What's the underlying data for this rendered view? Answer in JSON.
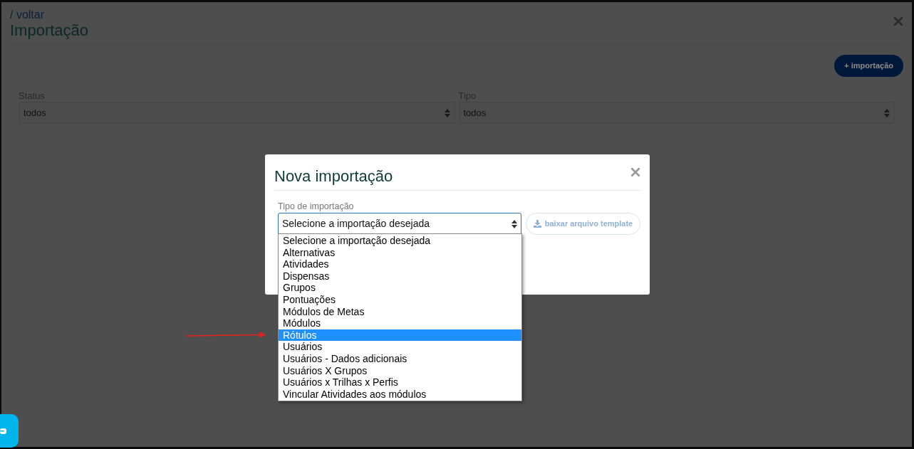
{
  "page": {
    "back_link": "/ voltar",
    "title": "Importação",
    "add_button": "+ importação",
    "filters": [
      {
        "label": "Status",
        "value": "todos"
      },
      {
        "label": "Tipo",
        "value": "todos"
      }
    ]
  },
  "dialog": {
    "title": "Nova importação",
    "field_label": "Tipo de importação",
    "field_value": "Selecione a importação desejada",
    "template_button": {
      "label": "baixar arquivo template",
      "disabled": true
    },
    "options": [
      {
        "label": "Selecione a importação desejada",
        "selected": false
      },
      {
        "label": "Alternativas",
        "selected": false
      },
      {
        "label": "Atividades",
        "selected": false
      },
      {
        "label": "Dispensas",
        "selected": false
      },
      {
        "label": "Grupos",
        "selected": false
      },
      {
        "label": "Pontuações",
        "selected": false
      },
      {
        "label": "Módulos de Metas",
        "selected": false
      },
      {
        "label": "Módulos",
        "selected": false
      },
      {
        "label": "Rótulos",
        "selected": true
      },
      {
        "label": "Usuários",
        "selected": false
      },
      {
        "label": "Usuários - Dados adicionais",
        "selected": false
      },
      {
        "label": "Usuários X Grupos",
        "selected": false
      },
      {
        "label": "Usuários x Trilhas x Perfis",
        "selected": false
      },
      {
        "label": "Vincular Atividades aos módulos",
        "selected": false
      }
    ]
  }
}
